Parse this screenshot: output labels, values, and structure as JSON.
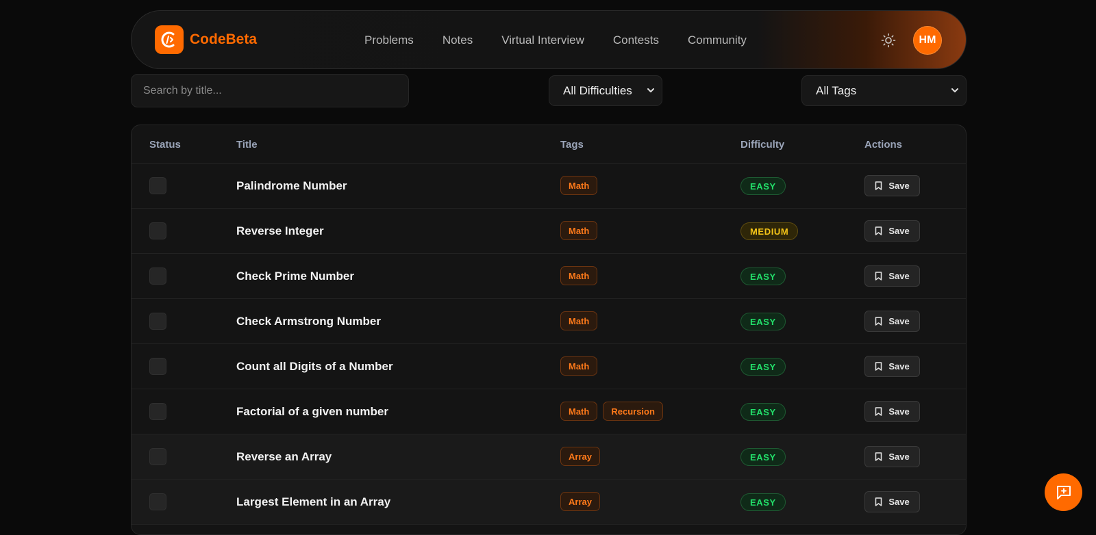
{
  "brand": {
    "name": "CodeBeta",
    "logo_icon": "code-logo-icon",
    "color": "#ff6a00"
  },
  "nav": {
    "links": [
      "Problems",
      "Notes",
      "Virtual Interview",
      "Contests",
      "Community"
    ],
    "theme_icon": "sun-icon",
    "avatar_initials": "HM"
  },
  "filters": {
    "search_placeholder": "Search by title...",
    "difficulty_selected": "All Difficulties",
    "tags_selected": "All Tags"
  },
  "table": {
    "headers": {
      "status": "Status",
      "title": "Title",
      "tags": "Tags",
      "difficulty": "Difficulty",
      "actions": "Actions"
    },
    "save_label": "Save",
    "rows": [
      {
        "title": "Palindrome Number",
        "tags": [
          "Math"
        ],
        "difficulty": "EASY"
      },
      {
        "title": "Reverse Integer",
        "tags": [
          "Math"
        ],
        "difficulty": "MEDIUM"
      },
      {
        "title": "Check Prime Number",
        "tags": [
          "Math"
        ],
        "difficulty": "EASY"
      },
      {
        "title": "Check Armstrong Number",
        "tags": [
          "Math"
        ],
        "difficulty": "EASY"
      },
      {
        "title": "Count all Digits of a Number",
        "tags": [
          "Math"
        ],
        "difficulty": "EASY"
      },
      {
        "title": "Factorial of a given number",
        "tags": [
          "Math",
          "Recursion"
        ],
        "difficulty": "EASY"
      },
      {
        "title": "Reverse an Array",
        "tags": [
          "Array"
        ],
        "difficulty": "EASY"
      },
      {
        "title": "Largest Element in an Array",
        "tags": [
          "Array"
        ],
        "difficulty": "EASY"
      }
    ]
  },
  "colors": {
    "accent": "#ff6a00",
    "easy": "#22e06a",
    "medium": "#f5c518",
    "background": "#0a0a0a"
  },
  "fab_icon": "chat-plus-icon"
}
